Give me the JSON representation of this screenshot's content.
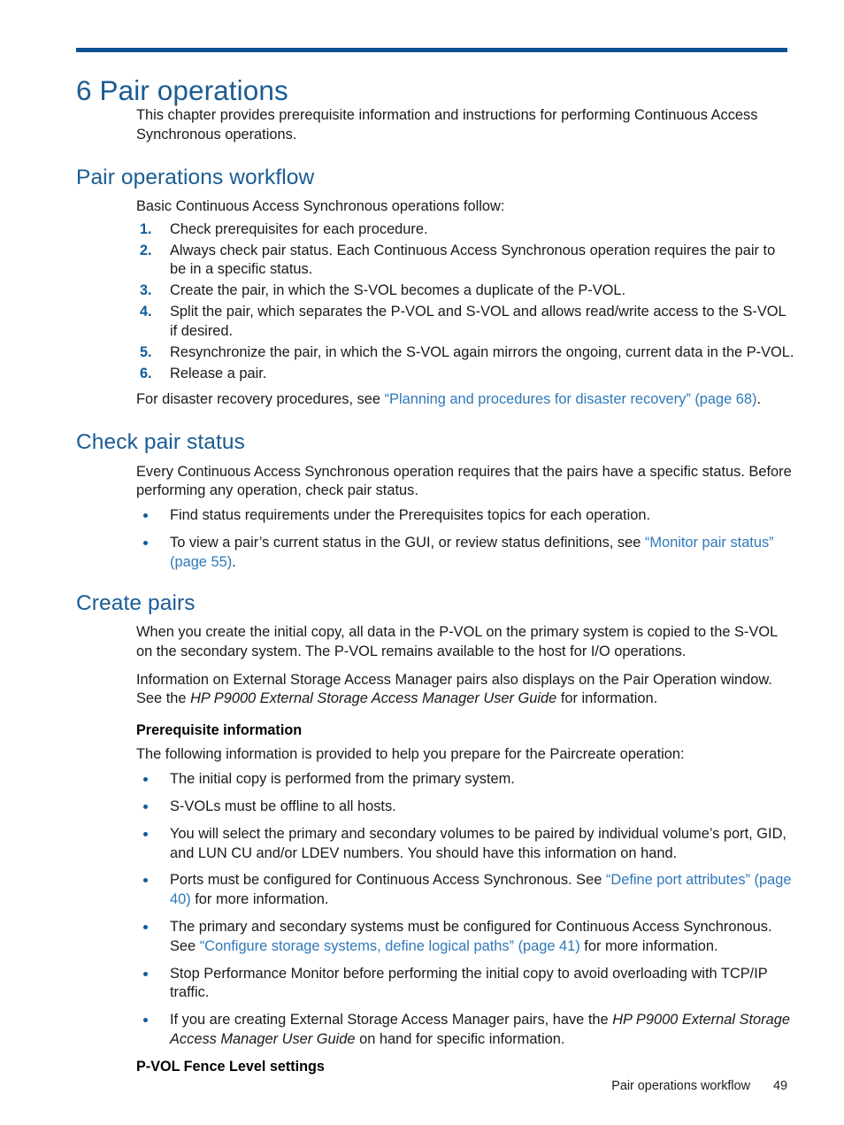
{
  "colors": {
    "rule": "#0b5290",
    "heading": "#1a5c94",
    "link": "#2f78b8",
    "marker": "#0f5c9c",
    "text": "#1a1a1a"
  },
  "chapter": {
    "title": "6 Pair operations",
    "intro": "This chapter provides prerequisite information and instructions for performing Continuous Access Synchronous operations."
  },
  "sections": {
    "workflow": {
      "heading": "Pair operations workflow",
      "lead": "Basic Continuous Access Synchronous operations follow:",
      "steps": [
        {
          "num": "1.",
          "text": "Check prerequisites for each procedure."
        },
        {
          "num": "2.",
          "text": "Always check pair status. Each Continuous Access Synchronous operation requires the pair to be in a specific status."
        },
        {
          "num": "3.",
          "text": "Create the pair, in which the S-VOL becomes a duplicate of the P-VOL."
        },
        {
          "num": "4.",
          "text": "Split the pair, which separates the P-VOL and S-VOL and allows read/write access to the S-VOL if desired."
        },
        {
          "num": "5.",
          "text": "Resynchronize the pair, in which the S-VOL again mirrors the ongoing, current data in the P-VOL."
        },
        {
          "num": "6.",
          "text": "Release a pair."
        }
      ],
      "closing_prefix": "For disaster recovery procedures, see ",
      "closing_link": "“Planning and procedures for disaster recovery” (page 68)",
      "closing_suffix": "."
    },
    "check_status": {
      "heading": "Check pair status",
      "intro": "Every Continuous Access Synchronous operation requires that the pairs have a specific status. Before performing any operation, check pair status.",
      "bullet_1": "Find status requirements under the Prerequisites topics for each operation.",
      "bullet_2_prefix": "To view a pair’s current status in the GUI, or review status definitions, see ",
      "bullet_2_link": "“Monitor pair status” (page 55)",
      "bullet_2_suffix": "."
    },
    "create_pairs": {
      "heading": "Create pairs",
      "para_1": "When you create the initial copy, all data in the P-VOL on the primary system is copied to the S-VOL on the secondary system. The P-VOL remains available to the host for I/O operations.",
      "para_2_prefix": "Information on External Storage Access Manager pairs also displays on the Pair Operation window. See the ",
      "para_2_italic": "HP P9000 External Storage Access Manager User Guide",
      "para_2_suffix": " for information.",
      "prereq_heading": "Prerequisite information",
      "prereq_lead": "The following information is provided to help you prepare for the Paircreate operation:",
      "prereq_bullets": [
        {
          "text": "The initial copy is performed from the primary system."
        },
        {
          "text": "S-VOLs must be offline to all hosts."
        },
        {
          "text": "You will select the primary and secondary volumes to be paired by individual volume’s port, GID, and LUN CU and/or LDEV numbers. You should have this information on hand."
        },
        {
          "prefix": "Ports must be configured for Continuous Access Synchronous. See ",
          "link": "“Define port attributes” (page 40)",
          "suffix": " for more information."
        },
        {
          "prefix": "The primary and secondary systems must be configured for Continuous Access Synchronous. See ",
          "link": "“Configure storage systems, define logical paths” (page 41)",
          "suffix": " for more information."
        },
        {
          "text": "Stop Performance Monitor before performing the initial copy to avoid overloading with TCP/IP traffic."
        },
        {
          "prefix": "If you are creating External Storage Access Manager pairs, have the ",
          "italic": "HP P9000 External Storage Access Manager User Guide",
          "suffix": " on hand for specific information."
        }
      ],
      "fence_heading": "P-VOL Fence Level settings"
    }
  },
  "footer": {
    "title": "Pair operations workflow",
    "page": "49"
  }
}
